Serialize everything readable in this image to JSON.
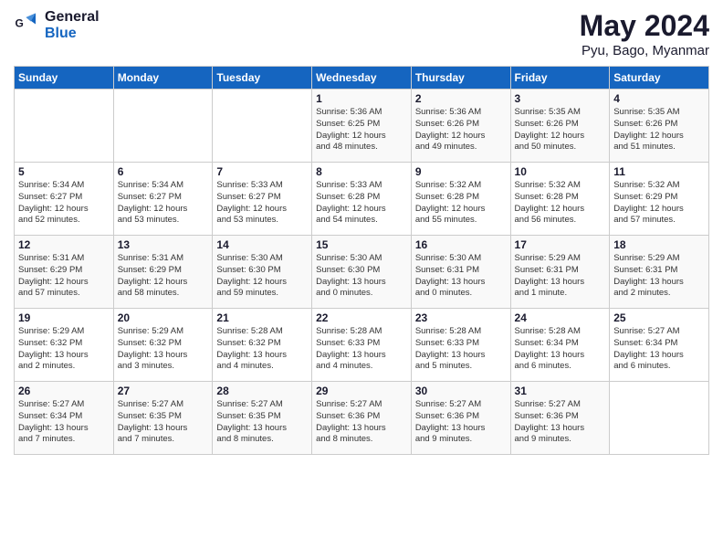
{
  "header": {
    "logo_general": "General",
    "logo_blue": "Blue",
    "month_year": "May 2024",
    "location": "Pyu, Bago, Myanmar"
  },
  "days_of_week": [
    "Sunday",
    "Monday",
    "Tuesday",
    "Wednesday",
    "Thursday",
    "Friday",
    "Saturday"
  ],
  "weeks": [
    [
      {
        "day": "",
        "info": ""
      },
      {
        "day": "",
        "info": ""
      },
      {
        "day": "",
        "info": ""
      },
      {
        "day": "1",
        "info": "Sunrise: 5:36 AM\nSunset: 6:25 PM\nDaylight: 12 hours\nand 48 minutes."
      },
      {
        "day": "2",
        "info": "Sunrise: 5:36 AM\nSunset: 6:26 PM\nDaylight: 12 hours\nand 49 minutes."
      },
      {
        "day": "3",
        "info": "Sunrise: 5:35 AM\nSunset: 6:26 PM\nDaylight: 12 hours\nand 50 minutes."
      },
      {
        "day": "4",
        "info": "Sunrise: 5:35 AM\nSunset: 6:26 PM\nDaylight: 12 hours\nand 51 minutes."
      }
    ],
    [
      {
        "day": "5",
        "info": "Sunrise: 5:34 AM\nSunset: 6:27 PM\nDaylight: 12 hours\nand 52 minutes."
      },
      {
        "day": "6",
        "info": "Sunrise: 5:34 AM\nSunset: 6:27 PM\nDaylight: 12 hours\nand 53 minutes."
      },
      {
        "day": "7",
        "info": "Sunrise: 5:33 AM\nSunset: 6:27 PM\nDaylight: 12 hours\nand 53 minutes."
      },
      {
        "day": "8",
        "info": "Sunrise: 5:33 AM\nSunset: 6:28 PM\nDaylight: 12 hours\nand 54 minutes."
      },
      {
        "day": "9",
        "info": "Sunrise: 5:32 AM\nSunset: 6:28 PM\nDaylight: 12 hours\nand 55 minutes."
      },
      {
        "day": "10",
        "info": "Sunrise: 5:32 AM\nSunset: 6:28 PM\nDaylight: 12 hours\nand 56 minutes."
      },
      {
        "day": "11",
        "info": "Sunrise: 5:32 AM\nSunset: 6:29 PM\nDaylight: 12 hours\nand 57 minutes."
      }
    ],
    [
      {
        "day": "12",
        "info": "Sunrise: 5:31 AM\nSunset: 6:29 PM\nDaylight: 12 hours\nand 57 minutes."
      },
      {
        "day": "13",
        "info": "Sunrise: 5:31 AM\nSunset: 6:29 PM\nDaylight: 12 hours\nand 58 minutes."
      },
      {
        "day": "14",
        "info": "Sunrise: 5:30 AM\nSunset: 6:30 PM\nDaylight: 12 hours\nand 59 minutes."
      },
      {
        "day": "15",
        "info": "Sunrise: 5:30 AM\nSunset: 6:30 PM\nDaylight: 13 hours\nand 0 minutes."
      },
      {
        "day": "16",
        "info": "Sunrise: 5:30 AM\nSunset: 6:31 PM\nDaylight: 13 hours\nand 0 minutes."
      },
      {
        "day": "17",
        "info": "Sunrise: 5:29 AM\nSunset: 6:31 PM\nDaylight: 13 hours\nand 1 minute."
      },
      {
        "day": "18",
        "info": "Sunrise: 5:29 AM\nSunset: 6:31 PM\nDaylight: 13 hours\nand 2 minutes."
      }
    ],
    [
      {
        "day": "19",
        "info": "Sunrise: 5:29 AM\nSunset: 6:32 PM\nDaylight: 13 hours\nand 2 minutes."
      },
      {
        "day": "20",
        "info": "Sunrise: 5:29 AM\nSunset: 6:32 PM\nDaylight: 13 hours\nand 3 minutes."
      },
      {
        "day": "21",
        "info": "Sunrise: 5:28 AM\nSunset: 6:32 PM\nDaylight: 13 hours\nand 4 minutes."
      },
      {
        "day": "22",
        "info": "Sunrise: 5:28 AM\nSunset: 6:33 PM\nDaylight: 13 hours\nand 4 minutes."
      },
      {
        "day": "23",
        "info": "Sunrise: 5:28 AM\nSunset: 6:33 PM\nDaylight: 13 hours\nand 5 minutes."
      },
      {
        "day": "24",
        "info": "Sunrise: 5:28 AM\nSunset: 6:34 PM\nDaylight: 13 hours\nand 6 minutes."
      },
      {
        "day": "25",
        "info": "Sunrise: 5:27 AM\nSunset: 6:34 PM\nDaylight: 13 hours\nand 6 minutes."
      }
    ],
    [
      {
        "day": "26",
        "info": "Sunrise: 5:27 AM\nSunset: 6:34 PM\nDaylight: 13 hours\nand 7 minutes."
      },
      {
        "day": "27",
        "info": "Sunrise: 5:27 AM\nSunset: 6:35 PM\nDaylight: 13 hours\nand 7 minutes."
      },
      {
        "day": "28",
        "info": "Sunrise: 5:27 AM\nSunset: 6:35 PM\nDaylight: 13 hours\nand 8 minutes."
      },
      {
        "day": "29",
        "info": "Sunrise: 5:27 AM\nSunset: 6:36 PM\nDaylight: 13 hours\nand 8 minutes."
      },
      {
        "day": "30",
        "info": "Sunrise: 5:27 AM\nSunset: 6:36 PM\nDaylight: 13 hours\nand 9 minutes."
      },
      {
        "day": "31",
        "info": "Sunrise: 5:27 AM\nSunset: 6:36 PM\nDaylight: 13 hours\nand 9 minutes."
      },
      {
        "day": "",
        "info": ""
      }
    ]
  ]
}
